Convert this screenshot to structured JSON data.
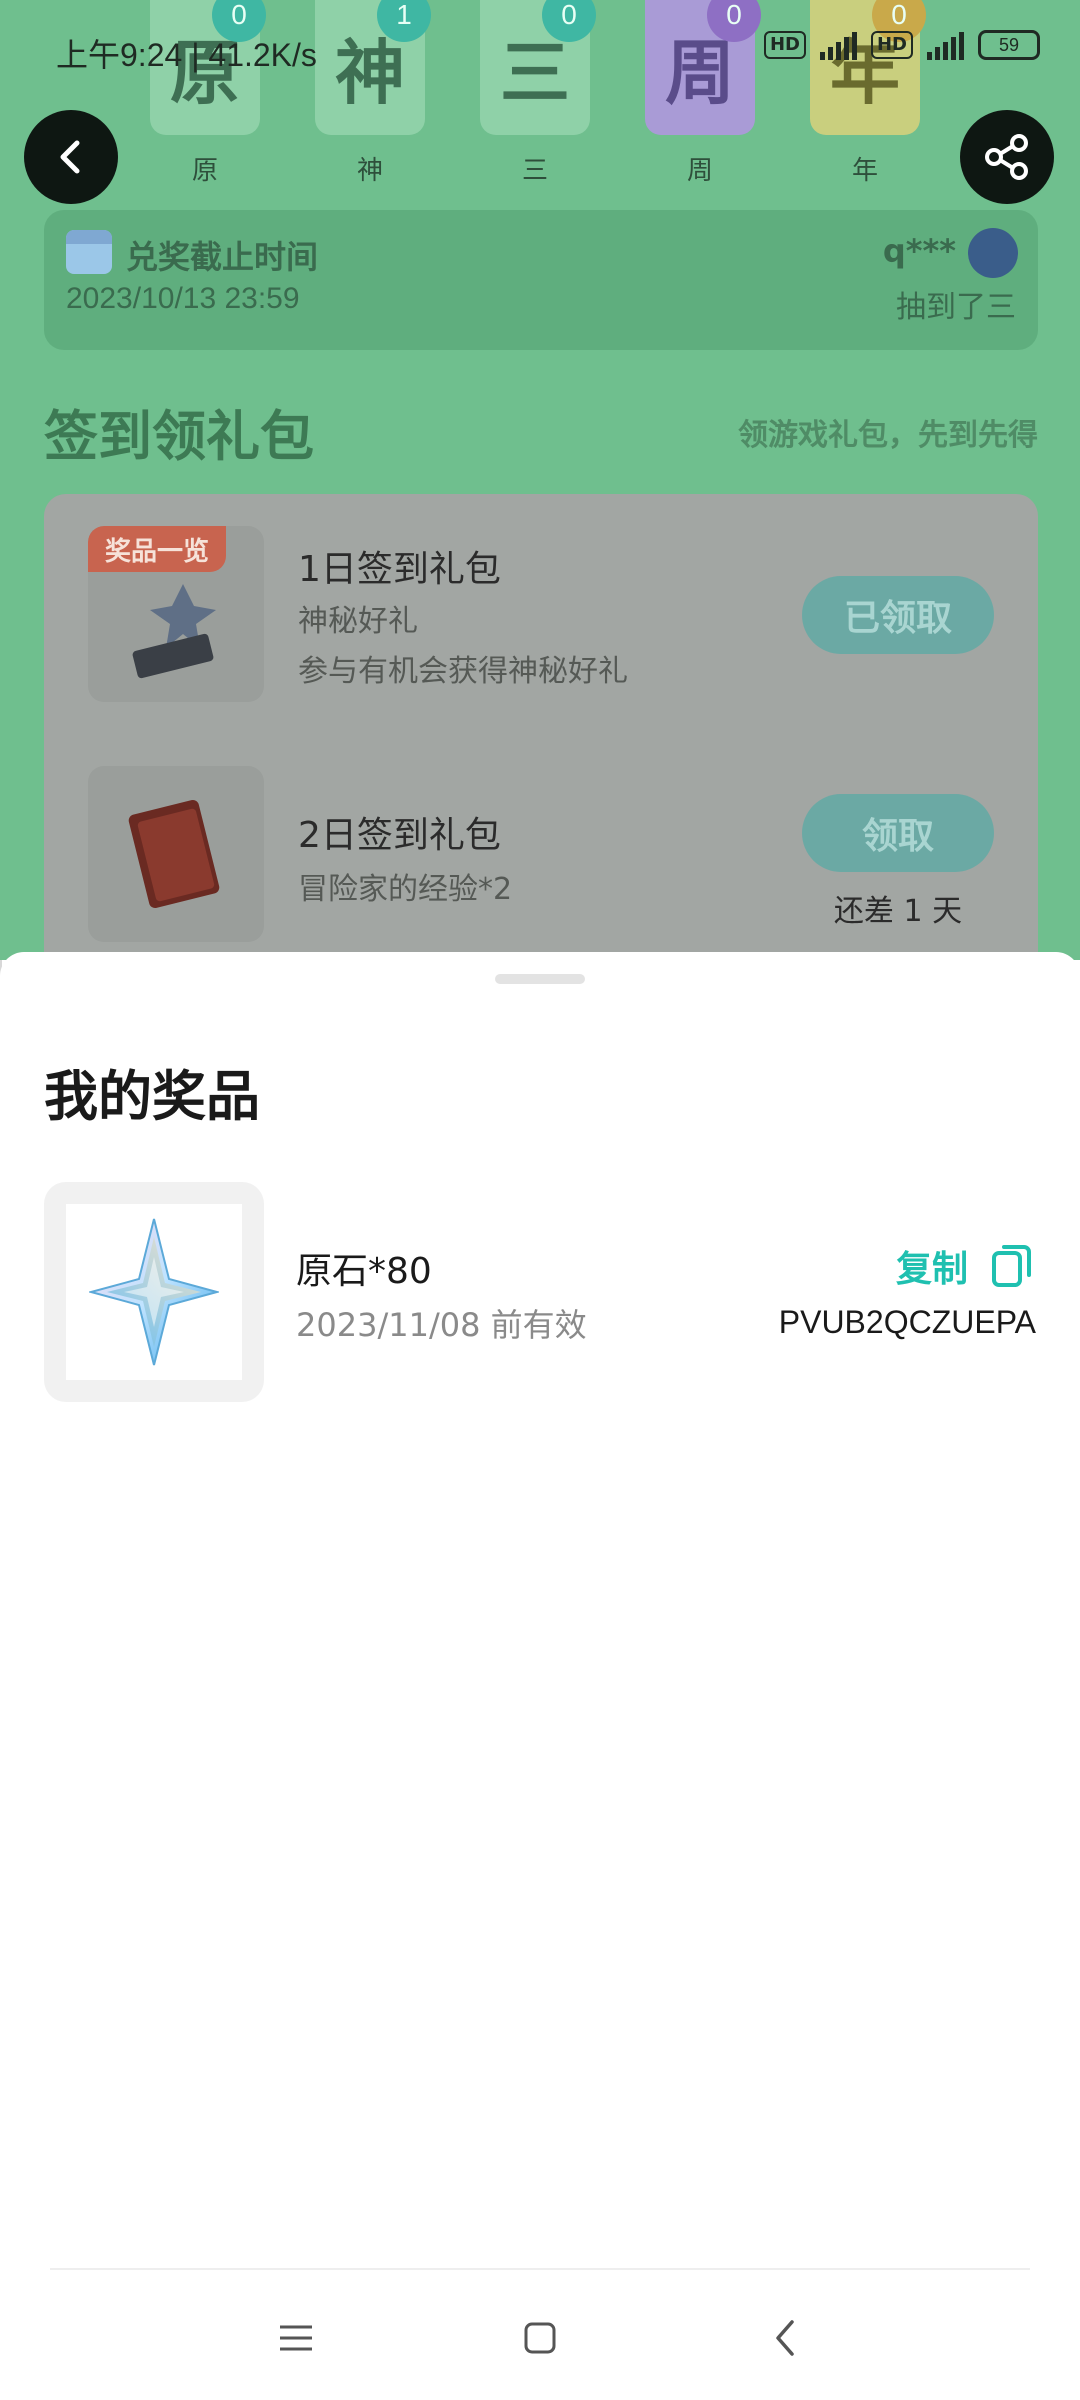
{
  "status_bar": {
    "time": "上午9:24",
    "net_speed": "41.2K/s",
    "net_tag_1": "HD",
    "net_tag_2": "HD",
    "battery": "59"
  },
  "characters": [
    {
      "glyph": "原",
      "count": "0",
      "label": "原"
    },
    {
      "glyph": "神",
      "count": "1",
      "label": "神"
    },
    {
      "glyph": "三",
      "count": "0",
      "label": "三"
    },
    {
      "glyph": "周",
      "count": "0",
      "label": "周"
    },
    {
      "glyph": "年",
      "count": "0",
      "label": "年"
    }
  ],
  "deadline": {
    "title": "兑奖截止时间",
    "date": "2023/10/13 23:59",
    "winner_name": "q***",
    "winner_text": "抽到了三"
  },
  "signin": {
    "title": "签到领礼包",
    "subtitle": "领游戏礼包，先到先得",
    "ribbon": "奖品一览",
    "items": [
      {
        "name": "1日签到礼包",
        "desc1": "神秘好礼",
        "desc2": "参与有机会获得神秘好礼",
        "button": "已领取"
      },
      {
        "name": "2日签到礼包",
        "desc1": "冒险家的经验*2",
        "button": "领取",
        "remaining": "还差 1 天"
      }
    ]
  },
  "sheet": {
    "title": "我的奖品",
    "prize": {
      "name": "原石*80",
      "expiry": "2023/11/08 前有效",
      "copy_label": "复制",
      "code": "PVUB2QCZUEPA"
    }
  },
  "colors": {
    "accent": "#1fc0b0",
    "background_green": "#6fbf8e"
  }
}
